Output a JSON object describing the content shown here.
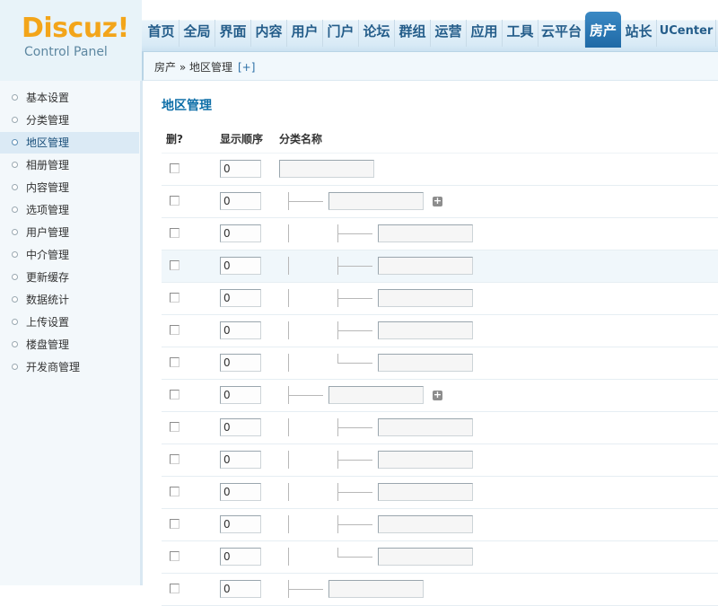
{
  "logo": {
    "brand": "Discuz!",
    "subtitle": "Control Panel"
  },
  "topnav": [
    {
      "label": "首页"
    },
    {
      "label": "全局"
    },
    {
      "label": "界面"
    },
    {
      "label": "内容"
    },
    {
      "label": "用户"
    },
    {
      "label": "门户"
    },
    {
      "label": "论坛"
    },
    {
      "label": "群组"
    },
    {
      "label": "运营"
    },
    {
      "label": "应用"
    },
    {
      "label": "工具"
    },
    {
      "label": "云平台"
    },
    {
      "label": "房产",
      "active": true
    },
    {
      "label": "站长"
    },
    {
      "label": "UCenter"
    }
  ],
  "breadcrumb": {
    "text": "房产 » 地区管理",
    "add": "[+]"
  },
  "sidebar": [
    {
      "label": "基本设置"
    },
    {
      "label": "分类管理"
    },
    {
      "label": "地区管理",
      "active": true
    },
    {
      "label": "相册管理"
    },
    {
      "label": "内容管理"
    },
    {
      "label": "选项管理"
    },
    {
      "label": "用户管理"
    },
    {
      "label": "中介管理"
    },
    {
      "label": "更新缓存"
    },
    {
      "label": "数据统计"
    },
    {
      "label": "上传设置"
    },
    {
      "label": "楼盘管理"
    },
    {
      "label": "开发商管理"
    }
  ],
  "main": {
    "title": "地区管理",
    "columns": {
      "delete": "删?",
      "order": "显示顺序",
      "name": "分类名称"
    },
    "rows": [
      {
        "level": 0,
        "order": "0",
        "name": ""
      },
      {
        "level": 1,
        "order": "0",
        "name": "",
        "add": true
      },
      {
        "level": 2,
        "order": "0",
        "name": ""
      },
      {
        "level": 2,
        "order": "0",
        "name": "",
        "highlight": true
      },
      {
        "level": 2,
        "order": "0",
        "name": ""
      },
      {
        "level": 2,
        "order": "0",
        "name": ""
      },
      {
        "level": 2,
        "order": "0",
        "name": "",
        "last": true
      },
      {
        "level": 1,
        "order": "0",
        "name": "",
        "add": true
      },
      {
        "level": 2,
        "order": "0",
        "name": ""
      },
      {
        "level": 2,
        "order": "0",
        "name": ""
      },
      {
        "level": 2,
        "order": "0",
        "name": ""
      },
      {
        "level": 2,
        "order": "0",
        "name": ""
      },
      {
        "level": 2,
        "order": "0",
        "name": "",
        "last": true
      },
      {
        "level": 1,
        "order": "0",
        "name": ""
      }
    ]
  }
}
